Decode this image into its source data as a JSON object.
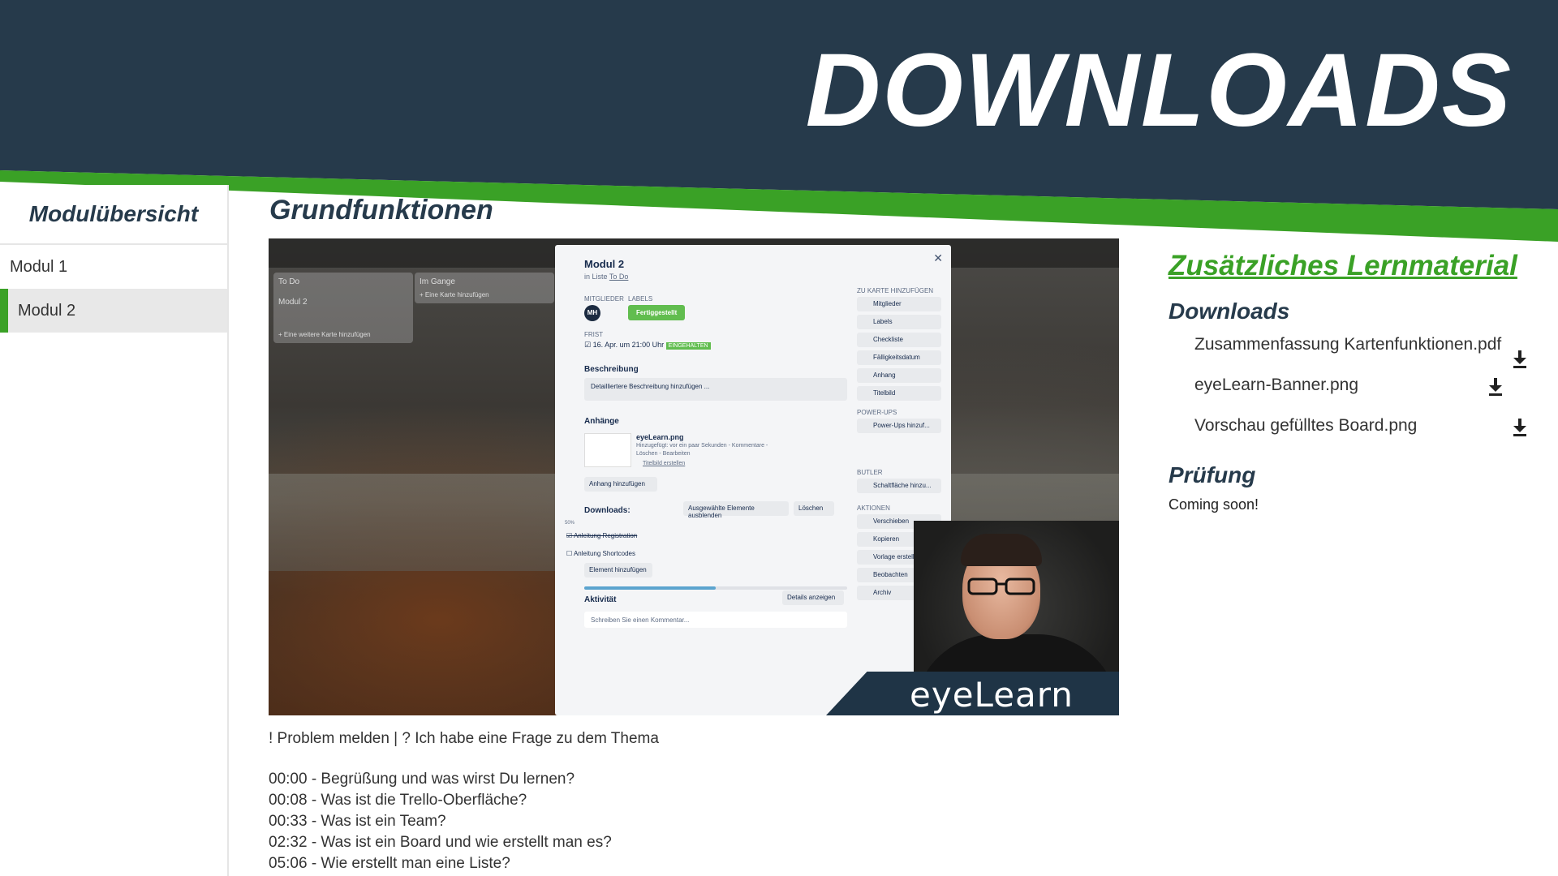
{
  "banner": {
    "title": "DOWNLOADS",
    "bg_color": "#263a4b",
    "accent_color": "#3aa126"
  },
  "sidebar": {
    "title": "Modulübersicht",
    "items": [
      {
        "label": "Modul 1",
        "active": false
      },
      {
        "label": "Modul 2",
        "active": true
      }
    ]
  },
  "main": {
    "heading": "Grundfunktionen",
    "video": {
      "trello_card": {
        "title": "Modul 2",
        "list_prefix": "in Liste",
        "list_name": "To Do",
        "members_label": "MITGLIEDER",
        "labels_label": "LABELS",
        "member_initials": "MH",
        "label_text": "Fertiggestellt",
        "due_label": "FRIST",
        "due_text": "16. Apr. um 21:00 Uhr",
        "due_badge": "EINGEHALTEN",
        "description_title": "Beschreibung",
        "description_placeholder": "Detailliertere Beschreibung hinzufügen ...",
        "attachments_title": "Anhänge",
        "attachment_name": "eyeLearn.png",
        "attachment_meta": "Hinzugefügt: vor ein paar Sekunden - Kommentare -",
        "attachment_actions": "Löschen - Bearbeiten",
        "attachment_cover": "Titelbild erstellen",
        "add_attachment": "Anhang hinzufügen",
        "checklist_title": "Downloads:",
        "hide_checked": "Ausgewählte Elemente ausblenden",
        "delete": "Löschen",
        "progress_label": "50%",
        "progress": 0.5,
        "checklist_items": [
          {
            "label": "Anleitung Registration",
            "checked": true
          },
          {
            "label": "Anleitung Shortcodes",
            "checked": false
          }
        ],
        "add_item": "Element hinzufügen",
        "activity_title": "Aktivität",
        "show_details": "Details anzeigen",
        "comment_placeholder": "Schreiben Sie einen Kommentar...",
        "sidebar_add_title": "ZU KARTE HINZUFÜGEN",
        "sidebar_add": [
          "Mitglieder",
          "Labels",
          "Checkliste",
          "Fälligkeitsdatum",
          "Anhang",
          "Titelbild"
        ],
        "powerups_title": "POWER-UPS",
        "powerups_button": "Power-Ups hinzuf...",
        "butler_title": "BUTLER",
        "butler_button": "Schaltfläche hinzu...",
        "actions_title": "AKTIONEN",
        "actions": [
          "Verschieben",
          "Kopieren",
          "Vorlage erstellen",
          "Beobachten",
          "Archiv"
        ]
      },
      "board_lists": [
        {
          "title": "To Do",
          "card": "Modul 2",
          "add": "+ Eine weitere Karte hinzufügen"
        },
        {
          "title": "Im Gange",
          "add": "+ Eine Karte hinzufügen"
        }
      ],
      "watermark": "eyeLearn"
    },
    "problem_line": "! Problem melden | ? Ich habe eine Frage zu dem Thema",
    "chapters": [
      "00:00 - Begrüßung und was wirst Du lernen?",
      "00:08 - Was ist die Trello-Oberfläche?",
      "00:33 - Was ist ein Team?",
      "02:32 - Was ist ein Board und wie erstellt man es?",
      "05:06 - Wie erstellt man eine Liste?"
    ]
  },
  "right_panel": {
    "heading": "Zusätzliches Lernmaterial",
    "downloads_title": "Downloads",
    "downloads": [
      {
        "label": "Zusammenfassung Kartenfunktionen.pdf",
        "icon": "download-icon"
      },
      {
        "label": "eyeLearn-Banner.png",
        "icon": "download-icon"
      },
      {
        "label": "Vorschau gefülltes Board.png",
        "icon": "download-icon"
      }
    ],
    "exam_title": "Prüfung",
    "exam_text": "Coming soon!"
  }
}
